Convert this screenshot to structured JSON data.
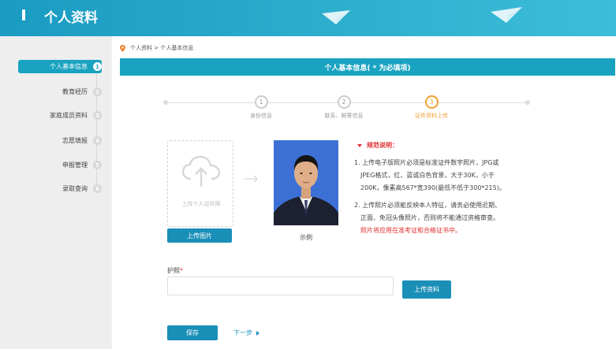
{
  "header": {
    "title": "个人资料"
  },
  "sidebar": {
    "items": [
      {
        "label": "个人基本信息",
        "num": "1",
        "active": true
      },
      {
        "label": "教育经历",
        "num": "2"
      },
      {
        "label": "家庭成员资料",
        "num": "3"
      },
      {
        "label": "志愿填报",
        "num": "4"
      },
      {
        "label": "申报管理",
        "num": "5"
      },
      {
        "label": "录取查询",
        "num": "6"
      }
    ]
  },
  "breadcrumb": "个人资料 > 个人基本信息",
  "banner": "个人基本信息( * 为必填项)",
  "steps": [
    {
      "num": "1",
      "label": "身份信息"
    },
    {
      "num": "2",
      "label": "联系、邮寄信息"
    },
    {
      "num": "3",
      "label": "证件资料上传",
      "active": true
    }
  ],
  "upload": {
    "placeholder": "上传个人证件照",
    "button": "上传图片"
  },
  "sample": {
    "label": "示例"
  },
  "rules": {
    "title": "规范说明：",
    "item1": [
      "1. 上传电子版照片必须是标准证件数字照片，JPG或",
      "JPEG格式，红、蓝或白色背景，大于30K，小于",
      "200K，像素高567*宽390(最低不低于300*215)。"
    ],
    "item2": [
      "2. 上传照片必须能反映本人特征，请务必使用近期、",
      "正面、免冠头像照片，否则将不能通过资格审查。"
    ],
    "item2_red": "照片将应用在准考证和合格证书中。"
  },
  "passport": {
    "label": "护照",
    "star": "*",
    "button": "上传资料"
  },
  "actions": {
    "save": "保存",
    "next": "下一步"
  },
  "colors": {
    "primary": "#1aa3c1",
    "accent": "#f0a030",
    "required": "#e03030"
  }
}
